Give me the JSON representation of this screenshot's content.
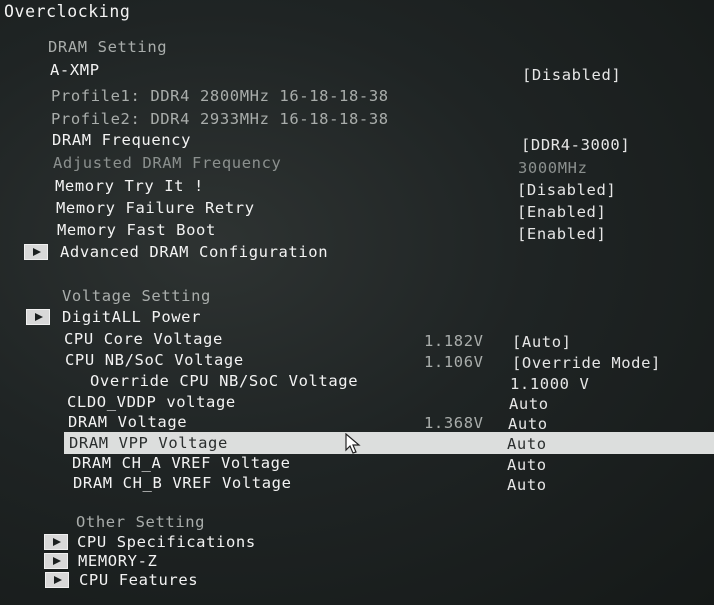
{
  "title": "Overclocking",
  "dram": {
    "heading": "DRAM Setting",
    "axmp": {
      "label": "A-XMP",
      "value": "[Disabled]"
    },
    "profile1": "Profile1: DDR4 2800MHz 16-18-18-38",
    "profile2": "Profile2: DDR4 2933MHz 16-18-18-38",
    "frequency": {
      "label": "DRAM Frequency",
      "value": "[DDR4-3000]"
    },
    "adjusted": {
      "label": "Adjusted DRAM Frequency",
      "value": "3000MHz"
    },
    "try_it": {
      "label": "Memory Try It !",
      "value": "[Disabled]"
    },
    "failure_retry": {
      "label": "Memory Failure Retry",
      "value": "[Enabled]"
    },
    "fast_boot": {
      "label": "Memory Fast Boot",
      "value": "[Enabled]"
    },
    "advanced": "Advanced DRAM Configuration"
  },
  "voltage": {
    "heading": "Voltage Setting",
    "digitall": "DigitALL Power",
    "cpu_core": {
      "label": "CPU Core Voltage",
      "reading": "1.182V",
      "value": "[Auto]"
    },
    "cpu_nb": {
      "label": "CPU NB/SoC Voltage",
      "reading": "1.106V",
      "value": "[Override Mode]"
    },
    "override_nb": {
      "label": "Override CPU NB/SoC Voltage",
      "value": "1.1000 V"
    },
    "cldo": {
      "label": "CLDO_VDDP voltage",
      "value": "Auto"
    },
    "dram_voltage": {
      "label": "DRAM Voltage",
      "reading": "1.368V",
      "value": "Auto"
    },
    "dram_vpp": {
      "label": "DRAM VPP Voltage",
      "value": "Auto"
    },
    "cha_vref": {
      "label": "DRAM CH_A VREF Voltage",
      "value": "Auto"
    },
    "chb_vref": {
      "label": "DRAM CH_B VREF Voltage",
      "value": "Auto"
    }
  },
  "other": {
    "heading": "Other Setting",
    "cpu_spec": "CPU Specifications",
    "memory_z": "MEMORY-Z",
    "cpu_features": "CPU Features"
  },
  "icons": {
    "submenu": "arrow-submenu-icon",
    "pointer": "mouse-pointer-icon"
  }
}
